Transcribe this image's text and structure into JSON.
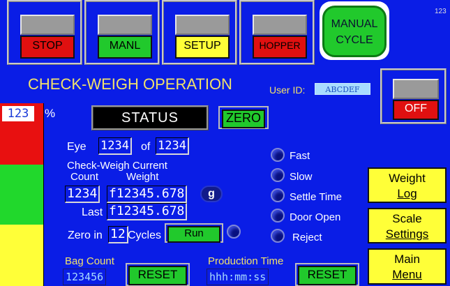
{
  "top_nav": {
    "stop": "STOP",
    "manl": "MANL",
    "setup": "SETUP",
    "hopper": "HOPPER",
    "manual_cycle_line1": "MANUAL",
    "manual_cycle_line2": "CYCLE",
    "corner_value": "123"
  },
  "header": {
    "title": "CHECK-WEIGH OPERATION",
    "user_id_label": "User ID:",
    "user_id_value": "ABCDEF"
  },
  "off_button": "OFF",
  "level": {
    "value": "123",
    "unit": "%",
    "colors": [
      "#e81010",
      "#21d82c",
      "#ffff38"
    ]
  },
  "status": {
    "label": "STATUS",
    "zero_button": "ZERO"
  },
  "eye": {
    "label": "Eye",
    "value": "1234",
    "of_label": "of",
    "total": "1234"
  },
  "current": {
    "heading": "Check-Weigh Current",
    "count_label": "Count",
    "weight_label": "Weight",
    "count_value": "1234",
    "weight_value": "f12345.678",
    "unit": "g",
    "last_label": "Last",
    "last_value": "f12345.678"
  },
  "zero_cycles": {
    "zero_in_label": "Zero in",
    "value": "12",
    "cycles_label": "Cycles",
    "run_button": "Run"
  },
  "lamps": [
    "Fast",
    "Slow",
    "Settle Time",
    "Door Open",
    "Reject"
  ],
  "right_buttons": {
    "weight_log_line1": "Weight",
    "weight_log_line2": "Log",
    "scale_settings_line1": "Scale",
    "scale_settings_line2": "Settings",
    "main_menu_line1": "Main",
    "main_menu_line2": "Menu"
  },
  "bag_count": {
    "label": "Bag Count",
    "value": "123456",
    "reset": "RESET"
  },
  "production_time": {
    "label": "Production Time",
    "value": "hhh:mm:ss",
    "reset": "RESET"
  }
}
